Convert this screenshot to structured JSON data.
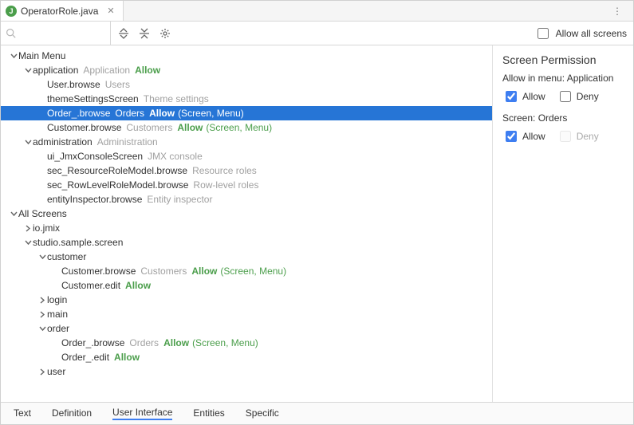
{
  "tab": {
    "title": "OperatorRole.java",
    "badge": "J"
  },
  "toolbar": {
    "allow_all_label": "Allow all screens"
  },
  "side": {
    "title": "Screen Permission",
    "menu_label": "Allow in menu:",
    "menu_value": "Application",
    "screen_label": "Screen:",
    "screen_value": "Orders",
    "allow": "Allow",
    "deny": "Deny"
  },
  "bottom_tabs": [
    "Text",
    "Definition",
    "User Interface",
    "Entities",
    "Specific"
  ],
  "bottom_active": 2,
  "tree": [
    {
      "d": 0,
      "exp": "open",
      "label": "Main Menu"
    },
    {
      "d": 1,
      "exp": "open",
      "label": "application",
      "hint": "Application",
      "perm": "Allow"
    },
    {
      "d": 2,
      "exp": "",
      "label": "User.browse",
      "hint": "Users"
    },
    {
      "d": 2,
      "exp": "",
      "label": "themeSettingsScreen",
      "hint": "Theme settings"
    },
    {
      "d": 2,
      "exp": "",
      "label": "Order_.browse",
      "hint": "Orders",
      "perm": "Allow",
      "scope": "(Screen, Menu)",
      "sel": true
    },
    {
      "d": 2,
      "exp": "",
      "label": "Customer.browse",
      "hint": "Customers",
      "perm": "Allow",
      "scope": "(Screen, Menu)"
    },
    {
      "d": 1,
      "exp": "open",
      "label": "administration",
      "hint": "Administration"
    },
    {
      "d": 2,
      "exp": "",
      "label": "ui_JmxConsoleScreen",
      "hint": "JMX console"
    },
    {
      "d": 2,
      "exp": "",
      "label": "sec_ResourceRoleModel.browse",
      "hint": "Resource roles"
    },
    {
      "d": 2,
      "exp": "",
      "label": "sec_RowLevelRoleModel.browse",
      "hint": "Row-level roles"
    },
    {
      "d": 2,
      "exp": "",
      "label": "entityInspector.browse",
      "hint": "Entity inspector"
    },
    {
      "d": 0,
      "exp": "open",
      "label": "All Screens"
    },
    {
      "d": 1,
      "exp": "closed",
      "label": "io.jmix"
    },
    {
      "d": 1,
      "exp": "open",
      "label": "studio.sample.screen"
    },
    {
      "d": 2,
      "exp": "open",
      "label": "customer"
    },
    {
      "d": 3,
      "exp": "",
      "label": "Customer.browse",
      "hint": "Customers",
      "perm": "Allow",
      "scope": "(Screen, Menu)"
    },
    {
      "d": 3,
      "exp": "",
      "label": "Customer.edit",
      "perm": "Allow"
    },
    {
      "d": 2,
      "exp": "closed",
      "label": "login"
    },
    {
      "d": 2,
      "exp": "closed",
      "label": "main"
    },
    {
      "d": 2,
      "exp": "open",
      "label": "order"
    },
    {
      "d": 3,
      "exp": "",
      "label": "Order_.browse",
      "hint": "Orders",
      "perm": "Allow",
      "scope": "(Screen, Menu)"
    },
    {
      "d": 3,
      "exp": "",
      "label": "Order_.edit",
      "perm": "Allow"
    },
    {
      "d": 2,
      "exp": "closed",
      "label": "user"
    }
  ]
}
